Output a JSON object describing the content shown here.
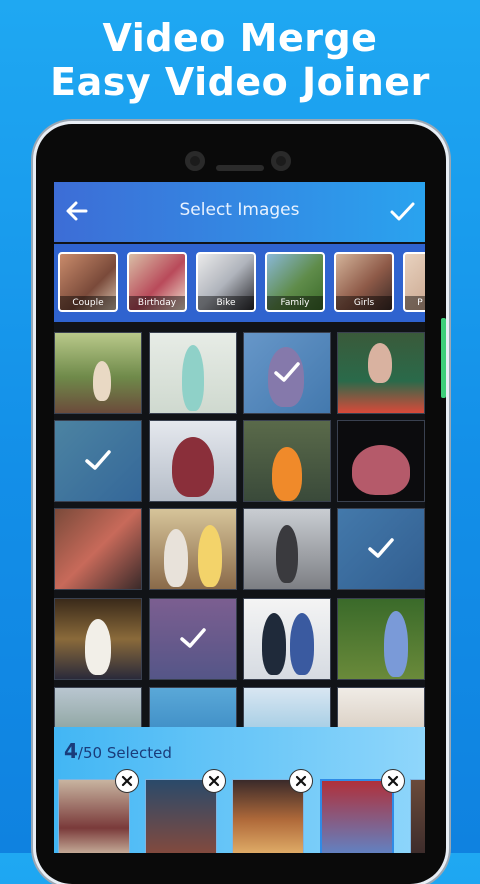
{
  "promo": {
    "line1": "Video Merge",
    "line2": "Easy Video Joiner"
  },
  "topbar": {
    "title": "Select Images",
    "back_icon": "arrow-left-icon",
    "confirm_icon": "check-icon"
  },
  "categories": [
    {
      "label": "Couple"
    },
    {
      "label": "Birthday"
    },
    {
      "label": "Bike"
    },
    {
      "label": "Family"
    },
    {
      "label": "Girls"
    },
    {
      "label": "P"
    }
  ],
  "selection": {
    "count": "4",
    "total_label": "/50 Selected"
  },
  "colors": {
    "accent": "#2aa3ef",
    "bar": "#2f63cf",
    "panel": "#42b6f4"
  }
}
